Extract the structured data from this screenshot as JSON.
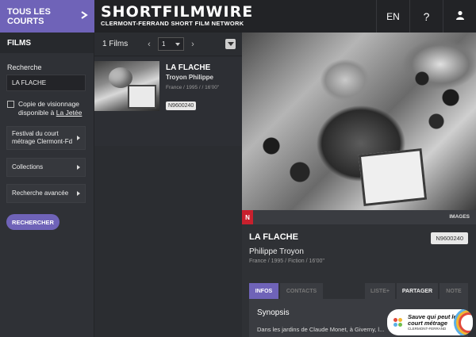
{
  "header": {
    "all_courts": "TOUS LES COURTS",
    "logo_main": "SHORTFILMWIRE",
    "logo_sub_prefix": "CLERMONT-FERRAND",
    "logo_sub_brand": "SHORT FILM NETWORK",
    "lang": "EN",
    "help": "?"
  },
  "sidebar": {
    "title": "FILMS",
    "search_label": "Recherche",
    "search_value": "LA FLACHE",
    "checkbox_label_prefix": "Copie de visionnage disponible à",
    "checkbox_link": "La Jetée",
    "dropdowns": [
      "Festival du court métrage Clermont-Fd",
      "Collections",
      "Recherche avancée"
    ],
    "search_button": "RECHERCHER"
  },
  "list": {
    "count": "1 Films",
    "page": "1",
    "prev": "‹",
    "next": "›",
    "items": [
      {
        "title": "LA FLACHE",
        "director": "Troyon Philippe",
        "meta": "France / 1995 / / 16'00''",
        "code": "N9600240"
      }
    ]
  },
  "detail": {
    "badge": "N",
    "images_label": "IMAGES",
    "title": "LA FLACHE",
    "code": "N9600240",
    "director": "Philippe Troyon",
    "meta": "France / 1995 / Fiction / 16'00''",
    "tabs": [
      "INFOS",
      "CONTACTS",
      "LISTE+",
      "PARTAGER",
      "NOTE"
    ],
    "synopsis_title": "Synopsis",
    "synopsis_text": "Dans les jardins de Claude Monet, à Giverny, l..."
  },
  "promo": {
    "text": "Sauve qui peut le court métrage",
    "sub": "CLERMONT-FERRAND"
  },
  "colors": {
    "accent": "#6f63b8",
    "badge_red": "#c8202d",
    "dot_colors": [
      "#e24a3b",
      "#f2b632",
      "#5bb0e8",
      "#6fbf4b"
    ]
  }
}
